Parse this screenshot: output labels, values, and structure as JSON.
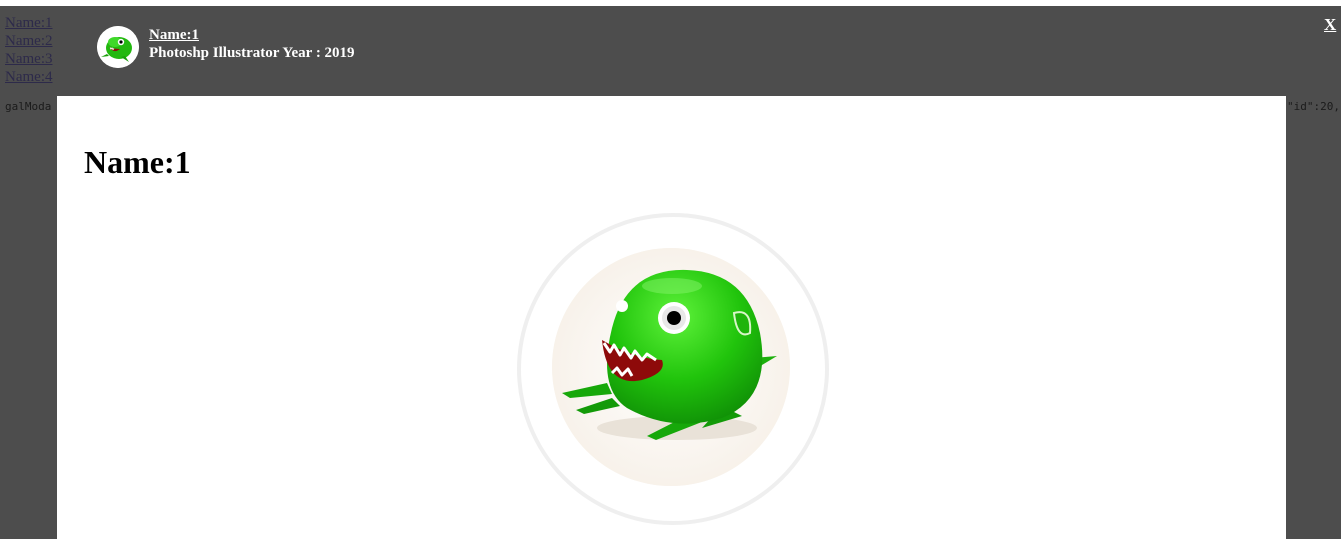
{
  "background_links": [
    "Name:1",
    "Name:2",
    "Name:3",
    "Name:4"
  ],
  "debug": {
    "left_text": "galModa",
    "right_text": "\"id\":20,"
  },
  "header": {
    "title": "Name:1",
    "subtitle": "Photoshp Illustrator Year : 2019",
    "avatar_icon": "green-monster-icon"
  },
  "close_label": "X",
  "modal": {
    "title": "Name:1",
    "image_icon": "green-monster-image"
  },
  "colors": {
    "overlay": "#4d4d4d",
    "modal_bg": "#ffffff",
    "monster_green": "#1fc40a",
    "ring": "#efefef"
  }
}
